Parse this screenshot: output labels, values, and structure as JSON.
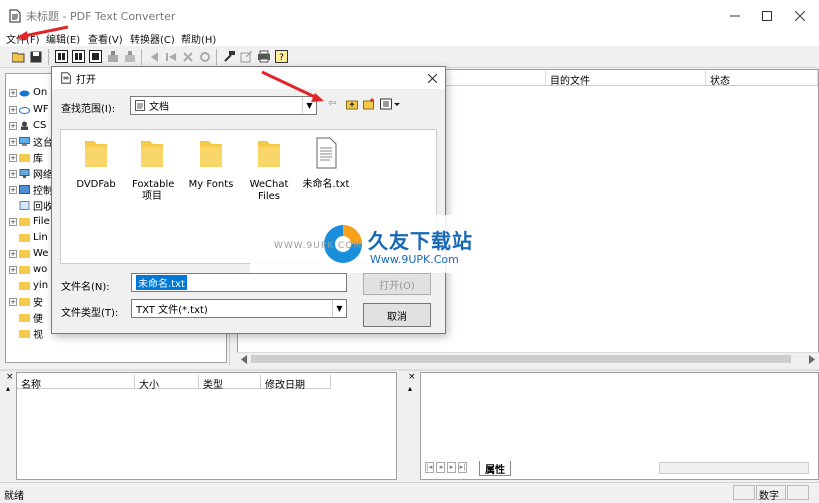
{
  "window": {
    "title": "未标题 - PDF Text Converter"
  },
  "menu": [
    "文件(F)",
    "编辑(E)",
    "查看(V)",
    "转换器(C)",
    "帮助(H)"
  ],
  "tree": [
    "On",
    "WF",
    "CS",
    "这台",
    "库",
    "网络",
    "控制",
    "回收",
    "File",
    "Lin",
    "We",
    "wo",
    "yin",
    "安",
    "便",
    "视"
  ],
  "right_panel": {
    "columns": [
      "目的文件",
      "状态"
    ]
  },
  "bottom_left": {
    "columns": [
      "名称",
      "大小",
      "类型",
      "修改日期"
    ]
  },
  "bottom_right": {
    "tab": "属性"
  },
  "status": {
    "left": "就绪",
    "right": "数字"
  },
  "dialog": {
    "title": "打开",
    "look_in_label": "查找范围(I):",
    "look_in_value": "文档",
    "files": [
      "DVDFab",
      "Foxtable项目",
      "My Fonts",
      "WeChat Files",
      "未命名.txt"
    ],
    "filename_label": "文件名(N):",
    "filename_value": "未命名.txt",
    "filetype_label": "文件类型(T):",
    "filetype_value": "TXT 文件(*.txt)",
    "open_button": "打开(O)",
    "cancel_button": "取消"
  },
  "watermark": {
    "brand": "久友下载站",
    "url": "Www.9UPK.Com",
    "url_small": "WWW.9UPK.COM"
  },
  "colors": {
    "folder": "#f5c94a",
    "arrow": "#e0262b",
    "accent_blue": "#0078d7"
  }
}
